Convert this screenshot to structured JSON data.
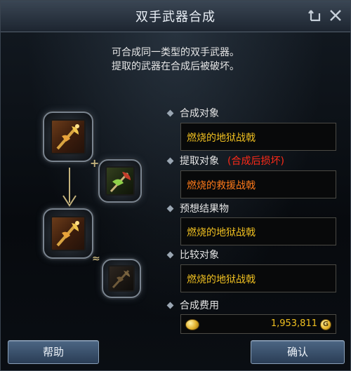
{
  "window": {
    "title": "双手武器合成",
    "controls": {
      "back_icon": "return-icon",
      "close_icon": "close-icon"
    }
  },
  "description": {
    "line1": "可合成同一类型的双手武器。",
    "line2": "提取的武器在合成后被破坏。"
  },
  "fields": [
    {
      "label": "合成对象",
      "value": "燃烧的地狱战戟",
      "value_color": "#f0c020"
    },
    {
      "label": "提取对象",
      "note": "(合成后损坏)",
      "value": "燃烧的救援战戟",
      "value_color": "#ff7a1a"
    },
    {
      "label": "预想结果物",
      "value": "燃烧的地狱战戟",
      "value_color": "#f0c020"
    },
    {
      "label": "比较对象",
      "value": "燃烧的地狱战戟",
      "value_color": "#f0c020"
    },
    {
      "label": "合成费用"
    }
  ],
  "cost": {
    "amount": "1,953,811"
  },
  "slots": {
    "target_icon": "halberd-icon",
    "material_icon": "axe-icon",
    "result_icon": "halberd-icon",
    "compare_icon": "halberd-icon"
  },
  "buttons": {
    "help": "帮助",
    "confirm": "确认"
  },
  "colors": {
    "accent": "#f0c020",
    "warning": "#ff2a18",
    "orange_item": "#ff7a1a"
  }
}
